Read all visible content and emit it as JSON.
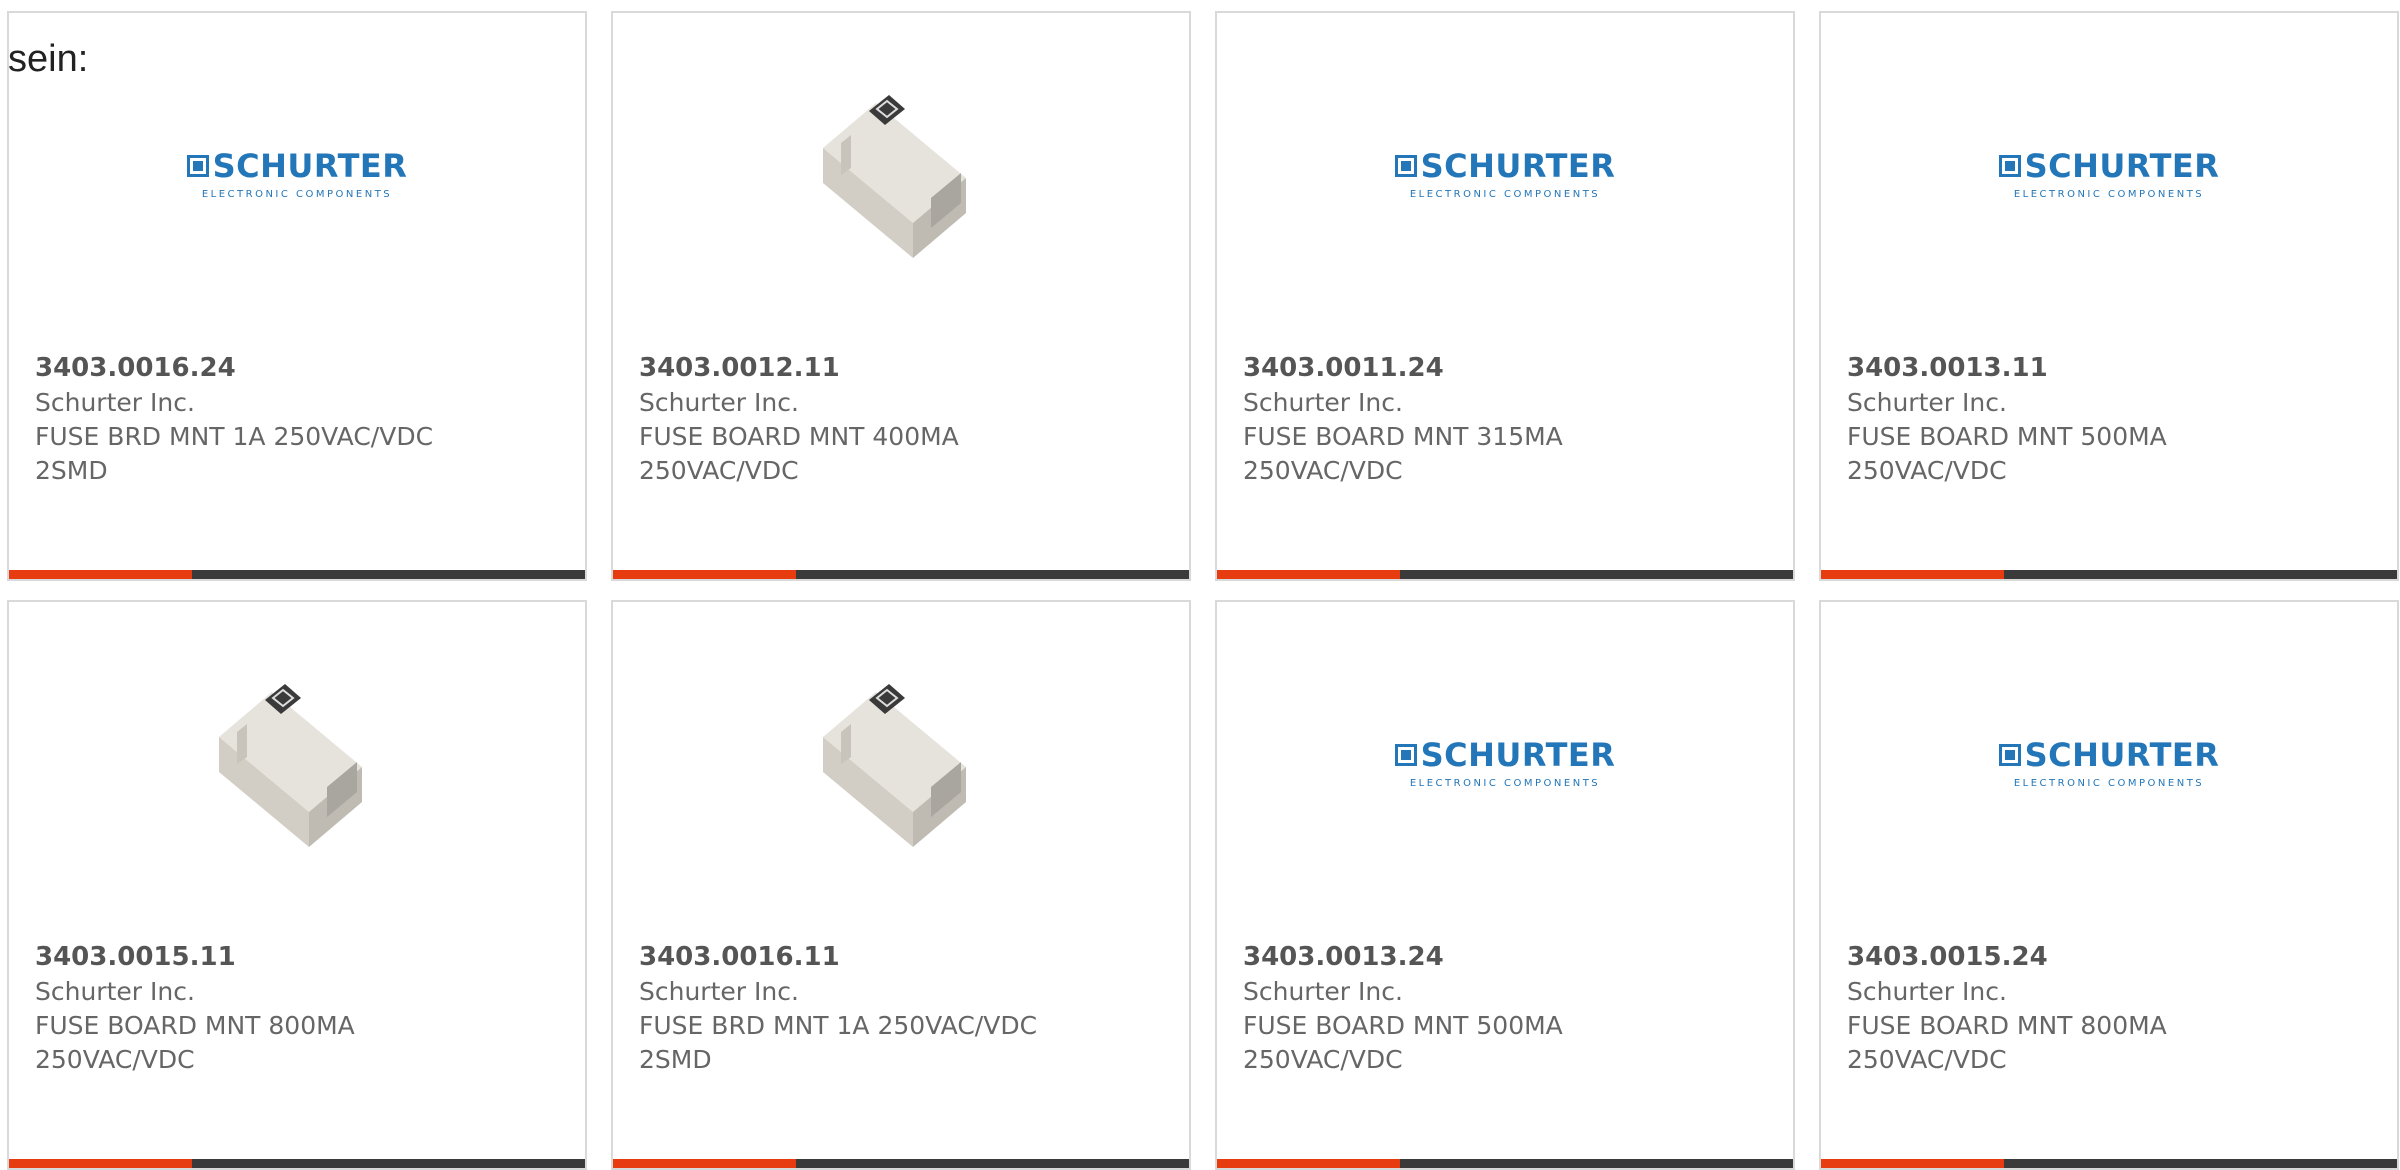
{
  "intro_text": "sein:",
  "colors": {
    "accent": "#e63c10",
    "bar": "#3a3a3a",
    "logo_blue": "#2376b8"
  },
  "products": [
    {
      "part_number": "3403.0016.24",
      "manufacturer": "Schurter Inc.",
      "description": "FUSE BRD MNT 1A 250VAC/VDC 2SMD",
      "image": "schurter-logo"
    },
    {
      "part_number": "3403.0012.11",
      "manufacturer": "Schurter Inc.",
      "description": "FUSE BOARD MNT 400MA 250VAC/VDC",
      "image": "fuse-photo"
    },
    {
      "part_number": "3403.0011.24",
      "manufacturer": "Schurter Inc.",
      "description": "FUSE BOARD MNT 315MA 250VAC/VDC",
      "image": "schurter-logo"
    },
    {
      "part_number": "3403.0013.11",
      "manufacturer": "Schurter Inc.",
      "description": "FUSE BOARD MNT 500MA 250VAC/VDC",
      "image": "schurter-logo"
    },
    {
      "part_number": "3403.0015.11",
      "manufacturer": "Schurter Inc.",
      "description": "FUSE BOARD MNT 800MA 250VAC/VDC",
      "image": "fuse-photo"
    },
    {
      "part_number": "3403.0016.11",
      "manufacturer": "Schurter Inc.",
      "description": "FUSE BRD MNT 1A 250VAC/VDC 2SMD",
      "image": "fuse-photo"
    },
    {
      "part_number": "3403.0013.24",
      "manufacturer": "Schurter Inc.",
      "description": "FUSE BOARD MNT 500MA 250VAC/VDC",
      "image": "schurter-logo"
    },
    {
      "part_number": "3403.0015.24",
      "manufacturer": "Schurter Inc.",
      "description": "FUSE BOARD MNT 800MA 250VAC/VDC",
      "image": "schurter-logo"
    }
  ],
  "logo": {
    "main": "SCHURTER",
    "sub": "ELECTRONIC COMPONENTS"
  }
}
